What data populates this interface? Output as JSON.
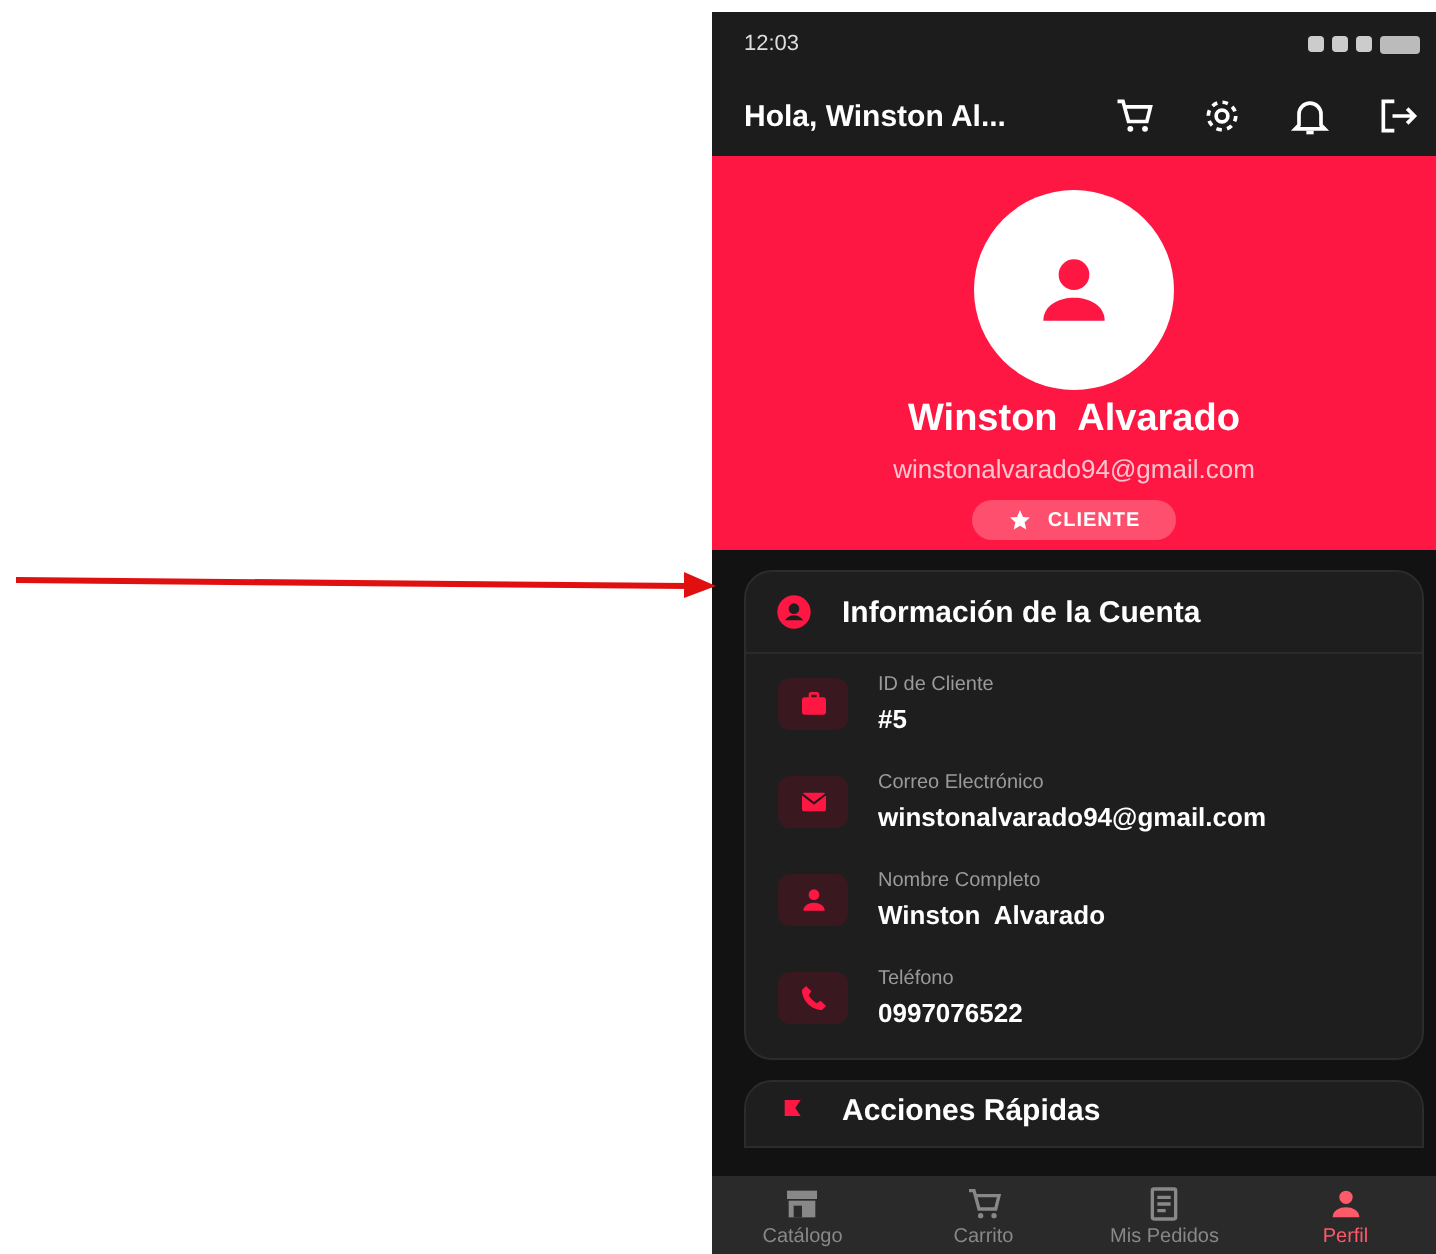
{
  "status_bar": {
    "time": "12:03"
  },
  "app_bar": {
    "title": "Hola, Winston  Al..."
  },
  "profile": {
    "name": "Winston  Alvarado",
    "email": "winstonalvarado94@gmail.com",
    "badge": "CLIENTE"
  },
  "account_card": {
    "title": "Información de la Cuenta",
    "fields": [
      {
        "kind": "id",
        "label": "ID de Cliente",
        "value": "#5"
      },
      {
        "kind": "email",
        "label": "Correo Electrónico",
        "value": "winstonalvarado94@gmail.com"
      },
      {
        "kind": "person",
        "label": "Nombre Completo",
        "value": "Winston  Alvarado"
      },
      {
        "kind": "phone",
        "label": "Teléfono",
        "value": "0997076522"
      }
    ]
  },
  "actions_card": {
    "title": "Acciones Rápidas"
  },
  "bottom_nav": [
    {
      "kind": "store",
      "label": "Catálogo",
      "selected": false
    },
    {
      "kind": "cart",
      "label": "Carrito",
      "selected": false
    },
    {
      "kind": "orders",
      "label": "Mis Pedidos",
      "selected": false
    },
    {
      "kind": "person",
      "label": "Perfil",
      "selected": true
    }
  ]
}
